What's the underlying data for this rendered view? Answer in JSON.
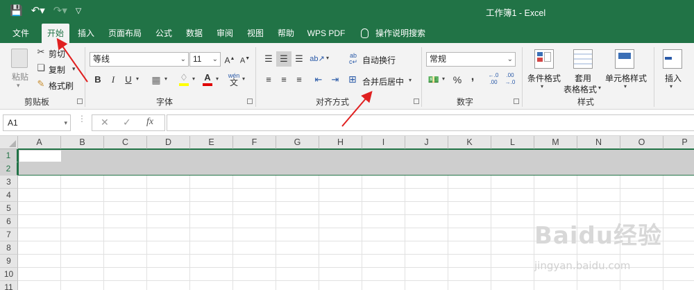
{
  "window": {
    "title": "工作簿1 - Excel"
  },
  "qat": {
    "save_icon": "save-icon",
    "undo_icon": "undo-icon",
    "redo_icon": "redo-icon",
    "customize_icon": "customize-qat-icon"
  },
  "tabs": [
    {
      "label": "文件"
    },
    {
      "label": "开始"
    },
    {
      "label": "插入"
    },
    {
      "label": "页面布局"
    },
    {
      "label": "公式"
    },
    {
      "label": "数据"
    },
    {
      "label": "审阅"
    },
    {
      "label": "视图"
    },
    {
      "label": "帮助"
    },
    {
      "label": "WPS PDF"
    }
  ],
  "tell_me": "操作说明搜索",
  "ribbon": {
    "clipboard": {
      "paste": "粘贴",
      "cut": "剪切",
      "copy": "复制",
      "format_painter": "格式刷",
      "label": "剪贴板"
    },
    "font": {
      "name": "等线",
      "size": "11",
      "bold": "B",
      "italic": "I",
      "underline": "U",
      "label": "字体"
    },
    "alignment": {
      "wrap": "自动换行",
      "merge": "合并后居中",
      "label": "对齐方式"
    },
    "number": {
      "format": "常规",
      "percent": "%",
      "comma": ",",
      "label": "数字"
    },
    "styles": {
      "conditional": "条件格式",
      "table_fmt_1": "套用",
      "table_fmt_2": "表格格式",
      "cell_styles": "单元格样式",
      "label": "样式"
    },
    "cells": {
      "insert": "插入"
    }
  },
  "formula_bar": {
    "name_box": "A1",
    "fx": "fx"
  },
  "columns": [
    "A",
    "B",
    "C",
    "D",
    "E",
    "F",
    "G",
    "H",
    "I",
    "J",
    "K",
    "L",
    "M",
    "N",
    "O",
    "P"
  ],
  "rows": [
    "1",
    "2",
    "3",
    "4",
    "5",
    "6",
    "7",
    "8",
    "9",
    "10",
    "11"
  ],
  "watermark": {
    "main": "Baidu经验",
    "sub": "jingyan.baidu.com"
  },
  "colors": {
    "accent": "#217346",
    "annotation": "#e02020"
  }
}
